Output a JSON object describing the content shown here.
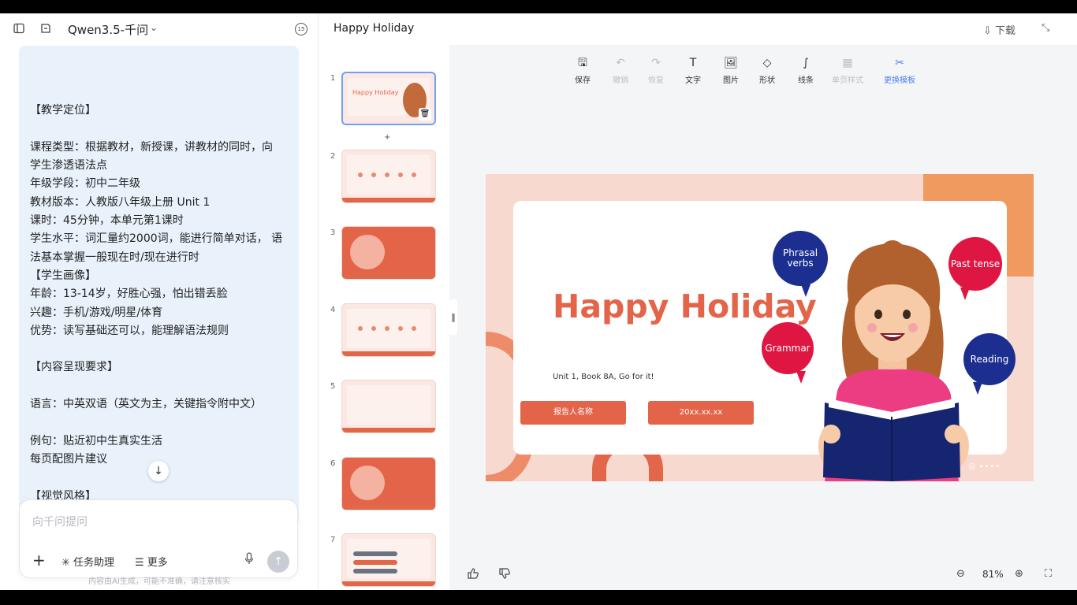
{
  "header": {
    "model_name": "Qwen3.5-千问",
    "badge": "15"
  },
  "message": {
    "lines": [
      "",
      "【教学定位】",
      "",
      "课程类型：根据教材，新授课，讲教材的同时，向",
      "学生渗透语法点",
      "年级学段：初中二年级",
      "教材版本：人教版八年级上册 Unit 1",
      "课时：45分钟，本单元第1课时",
      "学生水平：词汇量约2000词，能进行简单对话， 语",
      "法基本掌握一般现在时/现在进行时",
      "【学生画像】",
      "年龄：13-14岁，好胜心强，怕出错丢脸",
      "兴趣：手机/游戏/明星/体育",
      "优势：读写基础还可以，能理解语法规则",
      "",
      "【内容呈现要求】",
      "",
      "语言：中英双语（英文为主，关键指令附中文）",
      "",
      "例句：贴近初中生真实生活",
      "每页配图片建议",
      "",
      "【视觉风格】"
    ]
  },
  "composer": {
    "placeholder": "向千问提问",
    "task_label": "任务助理",
    "more_label": "更多",
    "disclaimer": "内容由AI生成，可能不准确，请注意核实"
  },
  "document": {
    "title": "Happy Holiday",
    "download_label": "下载"
  },
  "toolbar": [
    {
      "label": "保存",
      "icon": "save-icon",
      "state": "normal"
    },
    {
      "label": "撤销",
      "icon": "undo-icon",
      "state": "disabled"
    },
    {
      "label": "恢复",
      "icon": "redo-icon",
      "state": "disabled"
    },
    {
      "label": "文字",
      "icon": "text-icon",
      "state": "normal"
    },
    {
      "label": "图片",
      "icon": "image-icon",
      "state": "normal"
    },
    {
      "label": "形状",
      "icon": "shape-icon",
      "state": "normal"
    },
    {
      "label": "线条",
      "icon": "line-icon",
      "state": "normal"
    },
    {
      "label": "单页样式",
      "icon": "page-style-icon",
      "state": "disabled"
    },
    {
      "label": "更换模板",
      "icon": "template-icon",
      "state": "accent"
    }
  ],
  "thumbnails": [
    {
      "num": "1",
      "title": "Happy Holiday"
    },
    {
      "num": "2",
      "title": ""
    },
    {
      "num": "3",
      "title": ""
    },
    {
      "num": "4",
      "title": ""
    },
    {
      "num": "5",
      "title": ""
    },
    {
      "num": "6",
      "title": ""
    },
    {
      "num": "7",
      "title": ""
    }
  ],
  "slide": {
    "title": "Happy Holiday",
    "subtitle": "Unit 1, Book 8A, Go for it!",
    "reporter_button": "报告人名称",
    "date_button": "20xx.xx.xx",
    "bubbles": {
      "phrasal": "Phrasal verbs",
      "past": "Past tense",
      "grammar": "Grammar",
      "reading": "Reading"
    },
    "colors": {
      "accent": "#e4644a",
      "navy": "#1c2e8f",
      "red": "#df1641",
      "background": "#f8d9d0"
    }
  },
  "zoom": {
    "value": "81%"
  }
}
